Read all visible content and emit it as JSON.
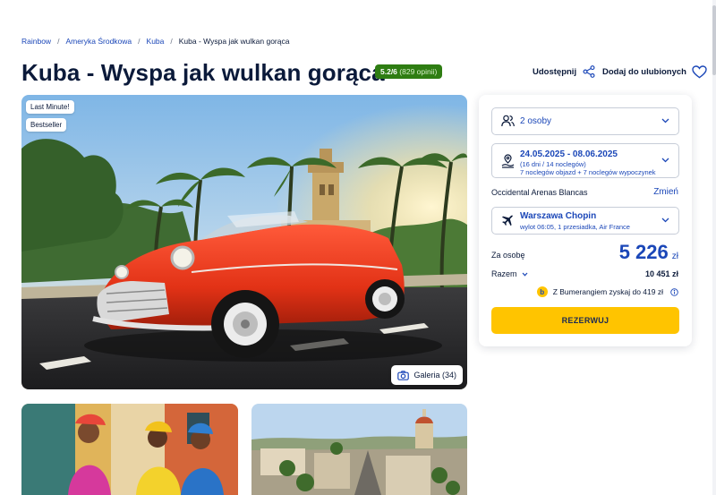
{
  "breadcrumb": {
    "items": [
      "Rainbow",
      "Ameryka Środkowa",
      "Kuba"
    ],
    "current": "Kuba - Wyspa jak wulkan gorąca",
    "separator": "/"
  },
  "offer": {
    "title": "Kuba - Wyspa jak wulkan gorąca",
    "rating_score": "5.2/6",
    "rating_count": "(829 opinii)"
  },
  "actions": {
    "share_label": "Udostępnij",
    "favorite_label": "Dodaj do ulubionych"
  },
  "gallery": {
    "badges": [
      "Last Minute!",
      "Bestseller"
    ],
    "button_label": "Galeria (34)"
  },
  "booking": {
    "persons": "2 osoby",
    "dates_main": "24.05.2025 - 08.06.2025",
    "dates_sub1": "(16 dni / 14 noclegów)",
    "dates_sub2": "7 noclegów objazd + 7 noclegów wypoczynek",
    "hotel": "Occidental Arenas Blancas",
    "change_label": "Zmień",
    "flight_main": "Warszawa Chopin",
    "flight_sub": "wylot 06:05, 1 przesiadka, Air France",
    "per_person_label": "Za osobę",
    "price": "5 226",
    "currency": "zł",
    "total_label": "Razem",
    "total_value": "10 451 zł",
    "boomerang_text": "Z Bumerangiem zyskaj do 419 zł",
    "reserve_label": "REZERWUJ"
  },
  "colors": {
    "brand_blue": "#1b47b8",
    "accent_yellow": "#ffc400",
    "rating_green": "#2e7d12",
    "text_dark": "#0b1a3a"
  }
}
